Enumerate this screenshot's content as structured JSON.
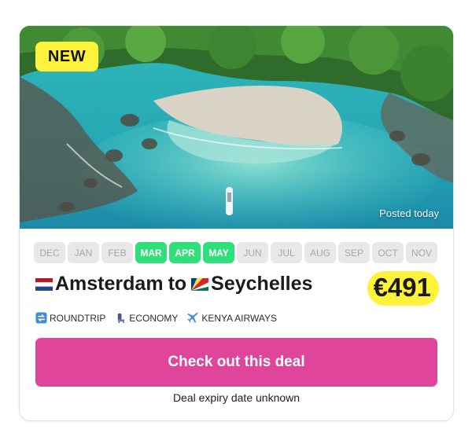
{
  "badge": "NEW",
  "posted_text": "Posted today",
  "months": [
    {
      "label": "DEC",
      "active": false
    },
    {
      "label": "JAN",
      "active": false
    },
    {
      "label": "FEB",
      "active": false
    },
    {
      "label": "MAR",
      "active": true
    },
    {
      "label": "APR",
      "active": true
    },
    {
      "label": "MAY",
      "active": true
    },
    {
      "label": "JUN",
      "active": false
    },
    {
      "label": "JUL",
      "active": false
    },
    {
      "label": "AUG",
      "active": false
    },
    {
      "label": "SEP",
      "active": false
    },
    {
      "label": "OCT",
      "active": false
    },
    {
      "label": "NOV",
      "active": false
    }
  ],
  "route": {
    "origin": "Amsterdam",
    "separator": "to",
    "destination": "Seychelles",
    "origin_flag": "netherlands-flag-icon",
    "destination_flag": "seychelles-flag-icon"
  },
  "price": "€491",
  "tags": [
    {
      "label": "ROUNDTRIP",
      "icon": "roundtrip-icon"
    },
    {
      "label": "ECONOMY",
      "icon": "seat-icon"
    },
    {
      "label": "KENYA AIRWAYS",
      "icon": "airplane-icon"
    }
  ],
  "cta_label": "Check out this deal",
  "expiry_text": "Deal expiry date unknown",
  "colors": {
    "accent_pink": "#e0459c",
    "active_green": "#2fe07a",
    "highlight_yellow": "#fff23a",
    "inactive_month": "#e8e8e8"
  }
}
